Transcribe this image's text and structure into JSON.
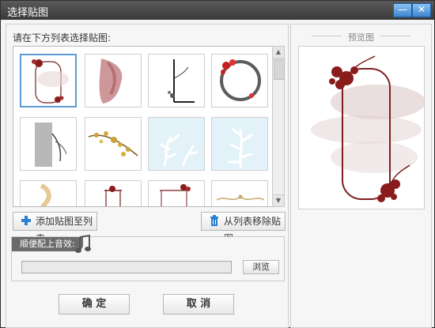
{
  "window": {
    "title": "选择贴图",
    "minimize_label": "—",
    "close_label": "✕"
  },
  "left": {
    "prompt": "请在下方列表选择贴图:",
    "thumbnails": [
      {
        "name": "scroll-frame-red-flowers",
        "selected": true
      },
      {
        "name": "red-ink-wash",
        "selected": false
      },
      {
        "name": "ink-plant-branch",
        "selected": false
      },
      {
        "name": "ink-circle-plum",
        "selected": false
      },
      {
        "name": "grey-ink-orchid",
        "selected": false
      },
      {
        "name": "golden-plum-branch",
        "selected": false
      },
      {
        "name": "white-coral-light-blue",
        "selected": false
      },
      {
        "name": "white-coral-light-blue-2",
        "selected": false
      },
      {
        "name": "gold-brush-strokes",
        "selected": false
      },
      {
        "name": "red-frame-columns",
        "selected": false
      },
      {
        "name": "red-frame-ornate",
        "selected": false
      },
      {
        "name": "gold-ornament-border",
        "selected": false
      }
    ],
    "add_button": "添加贴图至列表",
    "remove_button": "从列表移除贴图",
    "sound_label": "顺便配上音效:",
    "sound_path": "",
    "browse_button": "浏览",
    "ok_button": "确 定",
    "cancel_button": "取 消"
  },
  "right": {
    "preview_title": "预览图"
  },
  "colors": {
    "accent": "#3e86d1",
    "frame_red": "#7b1f1f",
    "titlebar": "#4a4a4a"
  }
}
